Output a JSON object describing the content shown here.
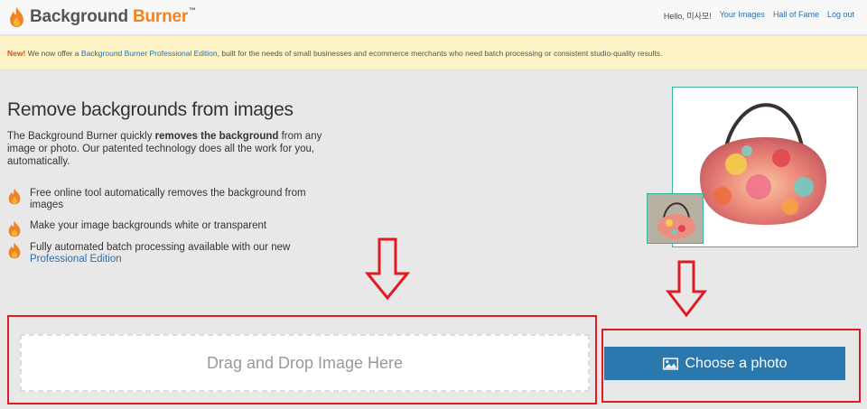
{
  "header": {
    "brand_first": "Background",
    "brand_second": "Burner",
    "brand_tm": "™",
    "greeting": "Hello, 미사모!",
    "nav": [
      "Your Images",
      "Hall of Fame",
      "Log out"
    ]
  },
  "banner": {
    "new_label": "New!",
    "text_before": " We now offer a ",
    "link": "Background Burner Professional Edition",
    "text_after": ", built for the needs of small businesses and ecommerce merchants who need batch processing or consistent studio-quality results."
  },
  "main": {
    "headline": "Remove backgrounds from images",
    "intro_before": "The Background Burner quickly ",
    "intro_bold": "removes the background",
    "intro_after": " from any image or photo. Our patented technology does all the work for you, automatically.",
    "features": [
      {
        "text": "Free online tool automatically removes the background from images",
        "icon": "flame-icon"
      },
      {
        "text": "Make your image backgrounds white or transparent",
        "icon": "flame-icon"
      },
      {
        "text": "Fully automated batch processing available with our new ",
        "link": "Professional Edition",
        "icon": "flame-icon"
      }
    ]
  },
  "upload": {
    "drop_label": "Drag and Drop Image Here",
    "choose_label": "Choose a photo",
    "choose_icon": "picture-icon"
  },
  "colors": {
    "accent_orange": "#f08322",
    "link_blue": "#2a6fb0",
    "button_blue": "#2a78ae",
    "highlight_red": "#e01b24",
    "banner_bg": "#fcf3c7",
    "frame_teal": "#39b39c"
  }
}
